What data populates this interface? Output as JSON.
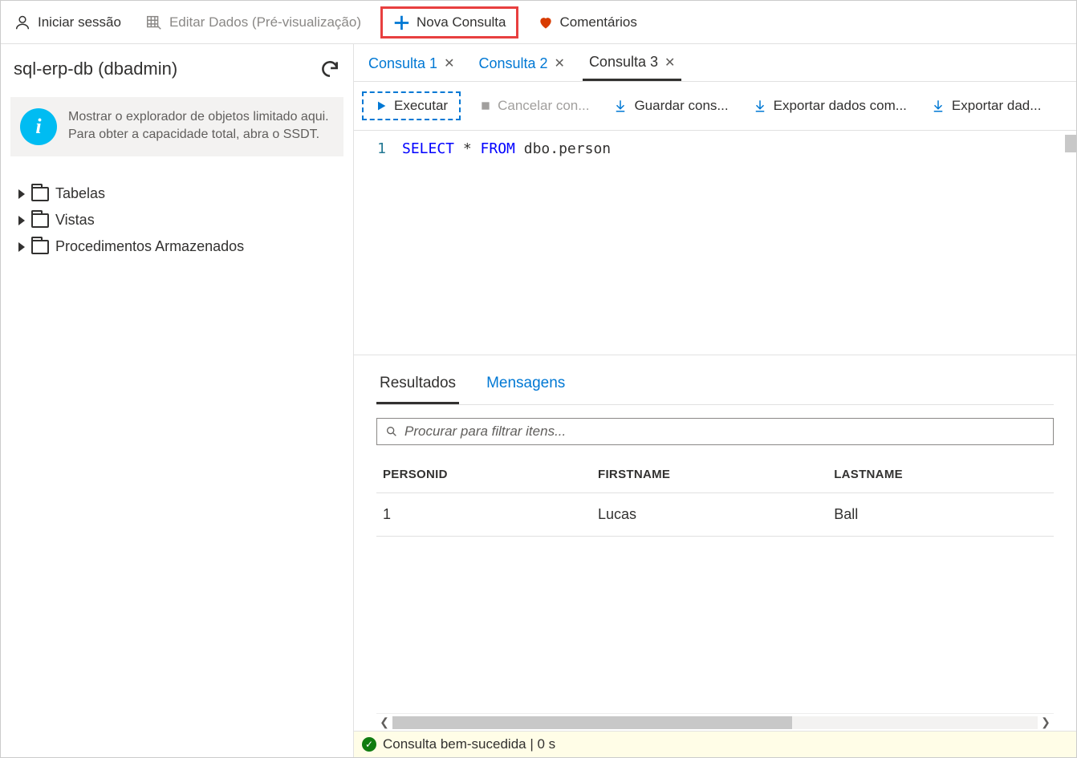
{
  "toolbar": {
    "signin": "Iniciar sessão",
    "edit_data": "Editar Dados (Pré-visualização)",
    "new_query": "Nova Consulta",
    "feedback": "Comentários"
  },
  "sidebar": {
    "title": "sql-erp-db (dbadmin)",
    "info_text": "Mostrar o explorador de objetos limitado aqui. Para obter a capacidade total, abra o SSDT.",
    "tree": [
      {
        "label": "Tabelas"
      },
      {
        "label": "Vistas"
      },
      {
        "label": "Procedimentos Armazenados"
      }
    ]
  },
  "tabs": [
    {
      "label": "Consulta 1",
      "active": false
    },
    {
      "label": "Consulta 2",
      "active": false
    },
    {
      "label": "Consulta 3",
      "active": true
    }
  ],
  "actions": {
    "run": "Executar",
    "cancel": "Cancelar con...",
    "save_query": "Guardar cons...",
    "export_data_as": "Exportar dados com...",
    "export_data": "Exportar dad..."
  },
  "editor": {
    "line_number": "1",
    "code_kw1": "SELECT",
    "code_mid": " * ",
    "code_kw2": "FROM",
    "code_rest": " dbo.person"
  },
  "results": {
    "tabs": {
      "results": "Resultados",
      "messages": "Mensagens"
    },
    "filter_placeholder": "Procurar para filtrar itens...",
    "columns": [
      "PERSONID",
      "FIRSTNAME",
      "LASTNAME"
    ],
    "rows": [
      {
        "PERSONID": "1",
        "FIRSTNAME": "Lucas",
        "LASTNAME": "Ball"
      }
    ]
  },
  "status": "Consulta bem-sucedida | 0 s"
}
